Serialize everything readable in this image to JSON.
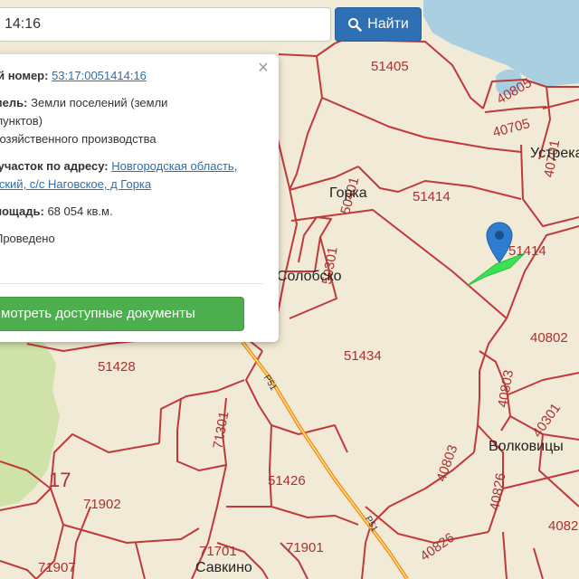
{
  "search": {
    "value": "14:16",
    "button_label": "Найти"
  },
  "popup": {
    "cad_label": "ый номер:",
    "cad_value": "53:17:0051414:16",
    "land_label": "емель:",
    "land_value_1": "Земли поселений (земли",
    "land_value_2": "х пунктов)",
    "land_value_3": "охозяйственного производства",
    "address_label": "й участок по адресу:",
    "address_link_1": "Новгородская область,",
    "address_link_2": "усский, с/с Наговское, д Горка",
    "area_label": "площадь:",
    "area_value": "68 054 кв.м.",
    "status_label": ":",
    "status_value": "Проведено",
    "docs_button": "мотреть доступные документы",
    "close_symbol": "×"
  },
  "map": {
    "parcels": [
      "51405",
      "40805",
      "40705",
      "40701",
      "51414",
      "50401",
      "51414",
      "50301",
      "40802",
      "51434",
      "51428",
      "40803",
      "40301",
      "71301",
      "40803",
      "40826",
      "40826",
      "51426",
      "71902",
      "71701",
      "71901",
      "71907",
      "4082"
    ],
    "places": [
      "Устрека",
      "Горка",
      "Солобско",
      "Волковицы",
      "Савкино"
    ],
    "roads": [
      "P51",
      "P51"
    ],
    "district_number": "17",
    "colors": {
      "land": "#f1ead6",
      "water": "#a9cfe0",
      "forest": "#cfe2a8",
      "boundary": "#c0393b",
      "road_outer": "#ee8a1e",
      "road_inner": "#ffe07a",
      "highlight": "#3de052",
      "marker": "#2f7dd1"
    }
  }
}
